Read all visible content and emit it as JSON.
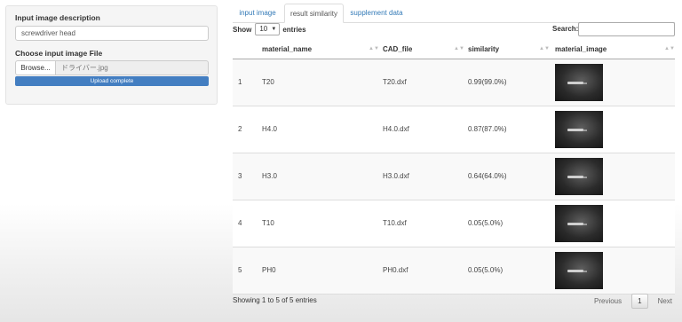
{
  "sidebar": {
    "description_label": "Input image description",
    "description_value": "screwdriver head",
    "file_label": "Choose input image File",
    "browse_label": "Browse...",
    "file_name": "ドライバー.jpg",
    "progress_text": "Upload complete",
    "progress_fraction": 1.0,
    "accent_color": "#437ec1"
  },
  "tabs": [
    {
      "label": "input image",
      "active": false
    },
    {
      "label": "result similarity",
      "active": true
    },
    {
      "label": "supplement data",
      "active": false
    }
  ],
  "controls": {
    "show_label": "Show",
    "page_size": "10",
    "entries_label": "entries",
    "search_label": "Search:",
    "search_value": ""
  },
  "table": {
    "headers": [
      "",
      "material_name",
      "CAD_file",
      "similarity",
      "material_image"
    ],
    "rows": [
      {
        "index": "1",
        "material_name": "T20",
        "cad_file": "T20.dxf",
        "similarity": "0.99(99.0%)"
      },
      {
        "index": "2",
        "material_name": "H4.0",
        "cad_file": "H4.0.dxf",
        "similarity": "0.87(87.0%)"
      },
      {
        "index": "3",
        "material_name": "H3.0",
        "cad_file": "H3.0.dxf",
        "similarity": "0.64(64.0%)"
      },
      {
        "index": "4",
        "material_name": "T10",
        "cad_file": "T10.dxf",
        "similarity": "0.05(5.0%)"
      },
      {
        "index": "5",
        "material_name": "PH0",
        "cad_file": "PH0.dxf",
        "similarity": "0.05(5.0%)"
      }
    ]
  },
  "footer": {
    "info": "Showing 1 to 5 of 5 entries",
    "previous": "Previous",
    "page": "1",
    "next": "Next"
  }
}
